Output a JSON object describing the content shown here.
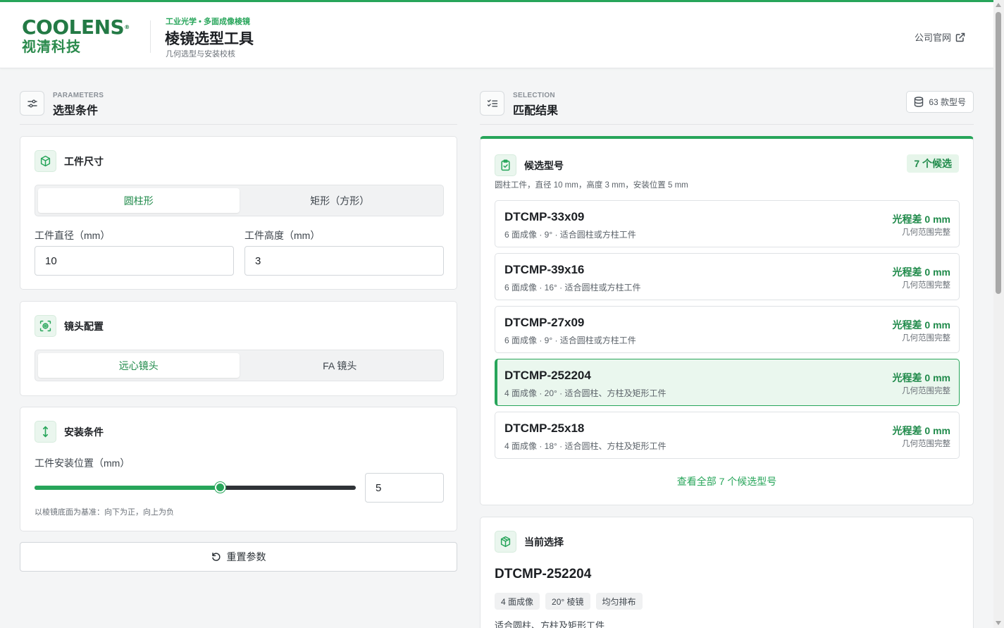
{
  "header": {
    "logo_word": "COOLENS",
    "logo_mark": "®",
    "logo_cn": "视清科技",
    "brand_tag": "工业光学 • 多面成像棱镜",
    "title": "棱镜选型工具",
    "subtitle": "几何选型与安装校核",
    "site_link": "公司官网"
  },
  "params": {
    "section_en": "PARAMETERS",
    "section_cn": "选型条件",
    "workpiece": {
      "title": "工件尺寸",
      "shapes": [
        "圆柱形",
        "矩形（方形）"
      ],
      "active_shape": "圆柱形",
      "diameter_label": "工件直径（mm）",
      "diameter_value": "10",
      "height_label": "工件高度（mm）",
      "height_value": "3"
    },
    "lens": {
      "title": "镜头配置",
      "options": [
        "远心镜头",
        "FA 镜头"
      ],
      "active": "远心镜头"
    },
    "mount": {
      "title": "安装条件",
      "position_label": "工件安装位置（mm）",
      "position_value": "5",
      "slider_fraction": 0.58,
      "hint": "以棱镜底面为基准：向下为正，向上为负"
    },
    "reset_label": "重置参数"
  },
  "selection": {
    "section_en": "SELECTION",
    "section_cn": "匹配结果",
    "model_count": "63 款型号",
    "candidates_title": "候选型号",
    "candidates_badge": "7 个候选",
    "candidates_desc": "圆柱工件，直径 10 mm，高度 3 mm，安装位置 5 mm",
    "items": [
      {
        "name": "DTCMP-33x09",
        "spec": "6 面成像 · 9° · 适合圆柱或方柱工件",
        "diff": "光程差 0 mm",
        "range": "几何范围完整",
        "selected": false
      },
      {
        "name": "DTCMP-39x16",
        "spec": "6 面成像 · 16° · 适合圆柱或方柱工件",
        "diff": "光程差 0 mm",
        "range": "几何范围完整",
        "selected": false
      },
      {
        "name": "DTCMP-27x09",
        "spec": "6 面成像 · 9° · 适合圆柱或方柱工件",
        "diff": "光程差 0 mm",
        "range": "几何范围完整",
        "selected": false
      },
      {
        "name": "DTCMP-252204",
        "spec": "4 面成像 · 20° · 适合圆柱、方柱及矩形工件",
        "diff": "光程差 0 mm",
        "range": "几何范围完整",
        "selected": true
      },
      {
        "name": "DTCMP-25x18",
        "spec": "4 面成像 · 18° · 适合圆柱、方柱及矩形工件",
        "diff": "光程差 0 mm",
        "range": "几何范围完整",
        "selected": false
      }
    ],
    "view_all": "查看全部 7 个候选型号",
    "current": {
      "title": "当前选择",
      "name": "DTCMP-252204",
      "tags": [
        "4 面成像",
        "20° 棱镜",
        "均匀排布"
      ],
      "desc": "适合圆柱、方柱及矩形工件"
    }
  },
  "colors": {
    "accent": "#27a55a",
    "accent_dark": "#1f8a4a",
    "selected_bg": "#eaf7ee"
  }
}
